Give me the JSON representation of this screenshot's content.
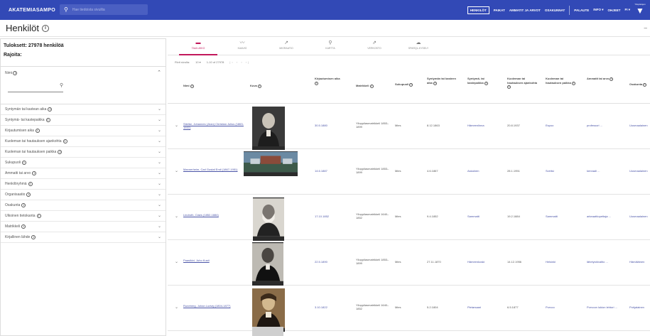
{
  "topbar": {
    "brand": "AKATEMIASAMPO",
    "search_placeholder": "Hae tiedoista sivuilta",
    "nav": [
      "HENKILÖT",
      "PAIKAT",
      "AMMATIT JA ARVOT",
      "OSAKUNNAT",
      "PALAUTE",
      "INFO ▾",
      "OHJEET",
      "FI ▾"
    ],
    "logo_text": "Yliopistojen"
  },
  "page": {
    "title": "Henkilöt"
  },
  "sidebar": {
    "results": "Tuloksett: 27978 henkilöä",
    "restrictions": "Rajoita:",
    "name_filter_label": "Nimi",
    "facets": [
      "Syntymän tai kastean aika",
      "Syntymä- tai kastepaikka",
      "Kirjautumisen aika",
      "Kuoleman tai hautauksen ajankohta",
      "Kuoleman tai hautauksen paikka",
      "Sukupuoli",
      "Ammatti tai arvo",
      "Henkilöryhmä",
      "Organisaatio",
      "Osakunta",
      "Ulkoinen tietokanta",
      "Matrikkeli",
      "Kirjallinen lähde"
    ]
  },
  "tabs": [
    {
      "icon": "▬",
      "label": "TAULUKKO"
    },
    {
      "icon": "〰",
      "label": "KAAVIO"
    },
    {
      "icon": "↗",
      "label": "MIGRAATIO"
    },
    {
      "icon": "⚲",
      "label": "KARTTA"
    },
    {
      "icon": "⇗",
      "label": "VERKOSTO"
    },
    {
      "icon": "☁",
      "label": "SPARQL-KYSELY"
    }
  ],
  "pager": {
    "rows_label": "Rivit sivulla:",
    "rows_value": "10 ▾",
    "range": "1-10 of 27978",
    "nav": "|‹ ‹ › ›|"
  },
  "table": {
    "headers": [
      "Nimi",
      "Kuva",
      "Kirjautumisen aika",
      "Matrikkeli",
      "Sukupuoli",
      "Syntymän tai kasteen aika",
      "Syntymä- tai kastepaikka",
      "Kuoleman tai hautauksen ajankohta",
      "Kuoleman tai hautauksen paikka",
      "Ammatit tai arvo",
      "Osakunta"
    ],
    "rows": [
      {
        "name": "Stielke, Johannes (Jean) Christian Julius (1863-1937)",
        "date": "30.5.1880",
        "matrikkeli": "Ylioppilasmatrikkeli 1853–1899",
        "sex": "Mies",
        "birth": "8.12.1863",
        "birthplace": "Hämeenlinna",
        "death": "20.8.1937",
        "deathplace": "Espoo",
        "occupation": "professori ...",
        "nation": "Uusmaalainen"
      },
      {
        "name": "Mannerheim, Carl Gustaf Emil (1867-1951)",
        "date": "14.6.1887",
        "matrikkeli": "Ylioppilasmatrikkeli 1853–1899",
        "sex": "Mies",
        "birth": "4.6.1867",
        "birthplace": "Askainen",
        "death": "28.1.1951",
        "deathplace": "Sveitsi",
        "occupation": "kenraali ...",
        "nation": "Uusmaalainen"
      },
      {
        "name": "Lindroth, Claes (1852-1884)",
        "date": "17.10.1852",
        "matrikkeli": "Ylioppilasmatrikkeli 1640–1852",
        "sex": "Mies",
        "birth": "9.4.1852",
        "birthplace": "Sammatti",
        "death": "19.2.1884",
        "deathplace": "Sammatti",
        "occupation": "arkeaattiopettaja ...",
        "nation": "Uusmaalainen"
      },
      {
        "name": "Paasikivi, Juho Kusti",
        "date": "22.5.1890",
        "matrikkeli": "Ylioppilasmatrikkeli 1853–1899",
        "sex": "Mies",
        "birth": "27.11.1870",
        "birthplace": "Hämeenkoski",
        "death": "14.12.1956",
        "deathplace": "Helsinki",
        "occupation": "lähetystövaltio ...",
        "nation": "Hämäläinen"
      },
      {
        "name": "Runeberg, Johan Ludvig (1804-1877)",
        "date": "3.10.1822",
        "matrikkeli": "Ylioppilasmatrikkeli 1640–1852",
        "sex": "Mies",
        "birth": "5.2.1804",
        "birthplace": "Pietarsaari",
        "death": "6.5.1877",
        "deathplace": "Porvoo",
        "occupation": "Porvoon lukion lehtori ...",
        "nation": "Pohjalainen"
      }
    ]
  }
}
